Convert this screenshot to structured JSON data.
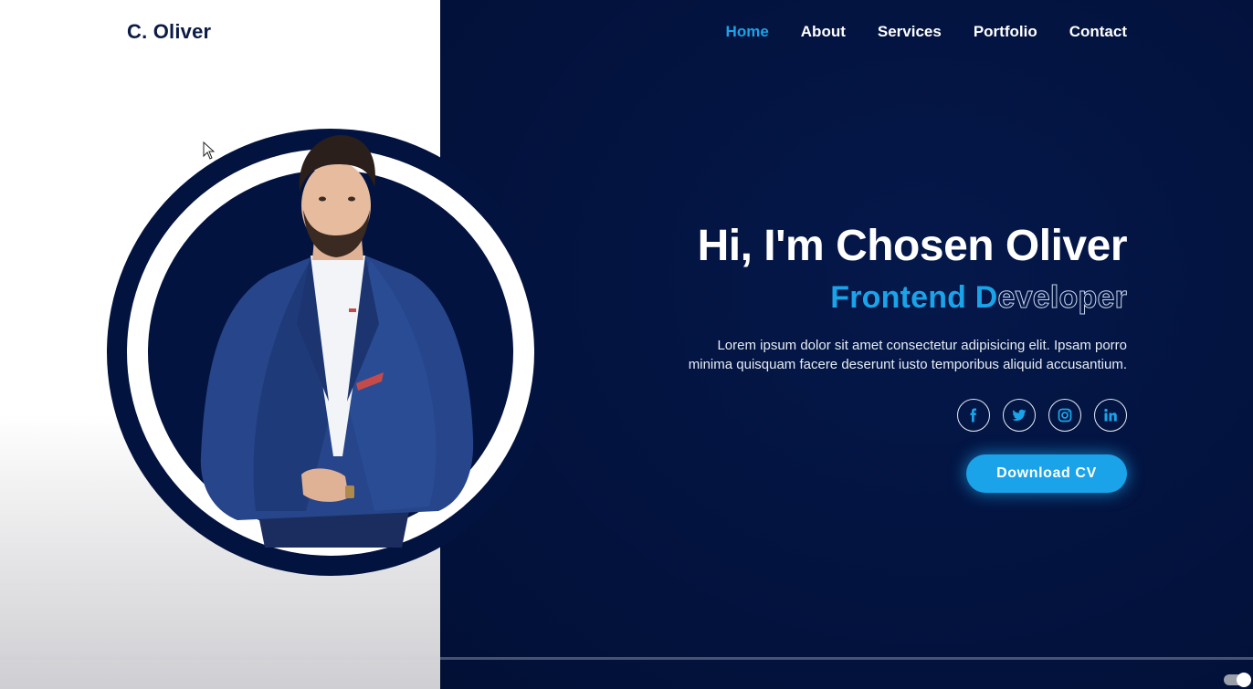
{
  "header": {
    "logo": "C. Oliver",
    "nav": [
      {
        "label": "Home",
        "active": true
      },
      {
        "label": "About",
        "active": false
      },
      {
        "label": "Services",
        "active": false
      },
      {
        "label": "Portfolio",
        "active": false
      },
      {
        "label": "Contact",
        "active": false
      }
    ]
  },
  "hero": {
    "title": "Hi, I'm Chosen Oliver",
    "subtitle_filled": "Frontend D",
    "subtitle_outlined": "eveloper",
    "description_line1": "Lorem ipsum dolor sit amet consectetur adipisicing elit. Ipsam porro",
    "description_line2": "minima quisquam facere deserunt iusto temporibus aliquid accusantium.",
    "socials": [
      {
        "icon": "facebook-icon"
      },
      {
        "icon": "twitter-icon"
      },
      {
        "icon": "instagram-icon"
      },
      {
        "icon": "linkedin-icon"
      }
    ],
    "cta_label": "Download CV"
  },
  "colors": {
    "accent": "#1aa3e8",
    "background": "#03133f",
    "panel": "#ffffff"
  }
}
